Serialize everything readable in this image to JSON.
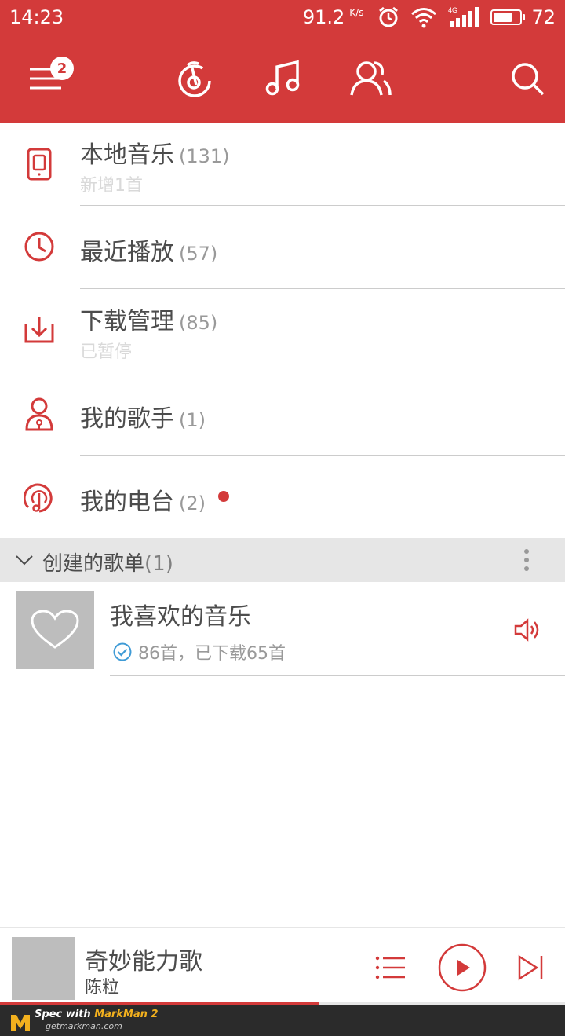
{
  "status_bar": {
    "time": "14:23",
    "net_speed": "91.2",
    "net_unit": "K/s",
    "network": "4G",
    "battery": "72",
    "battery_level": 0.72
  },
  "header": {
    "badge": "2",
    "tabs": [
      "music-tab",
      "note-tab",
      "friends-tab",
      "search-tab"
    ],
    "accent_color": "#d33a3a"
  },
  "list": {
    "local_music": {
      "title": "本地音乐",
      "count": "(131)",
      "sub": "新增1首"
    },
    "recent": {
      "title": "最近播放",
      "count": "(57)"
    },
    "downloads": {
      "title": "下载管理",
      "count": "(85)",
      "sub": "已暂停"
    },
    "artists": {
      "title": "我的歌手",
      "count": "(1)"
    },
    "radio": {
      "title": "我的电台",
      "count": "(2)"
    }
  },
  "playlists": {
    "header": {
      "label": "创建的歌单",
      "count": "(1)"
    },
    "items": [
      {
        "title": "我喜欢的音乐",
        "sub": "86首，已下载65首"
      }
    ]
  },
  "player": {
    "song": "奇妙能力歌",
    "artist": "陈粒",
    "progress": 0.565
  },
  "footer": {
    "prefix": "Spec with ",
    "brand": "MarkMan 2",
    "url": "getmarkman.com"
  },
  "colors": {
    "title": "#4c4c4c",
    "count": "#999999",
    "sub": "#d9d9d9",
    "divider": "#cccccc",
    "section_bg": "#e6e6e6",
    "section_count": "#808080",
    "playlist_title": "#4d4d4d"
  }
}
